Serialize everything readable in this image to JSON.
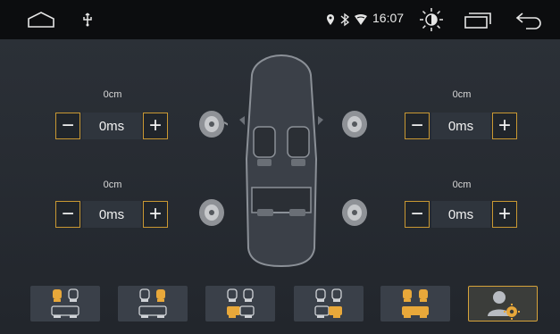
{
  "status_bar": {
    "time": "16:07",
    "icons": [
      "home-icon",
      "usb-icon",
      "location-icon",
      "bluetooth-icon",
      "wifi-icon",
      "brightness-icon",
      "recent-apps-icon",
      "back-icon"
    ]
  },
  "delay": {
    "front_left": {
      "distance": "0cm",
      "time": "0ms"
    },
    "front_right": {
      "distance": "0cm",
      "time": "0ms"
    },
    "rear_left": {
      "distance": "0cm",
      "time": "0ms"
    },
    "rear_right": {
      "distance": "0cm",
      "time": "0ms"
    },
    "minus_label": "−",
    "plus_label": "+"
  },
  "presets": {
    "icons": [
      "seat-driver-icon",
      "seat-front-right-icon",
      "seat-rear-left-icon",
      "seat-rear-right-icon",
      "seat-front-row-icon",
      "user-settings-icon"
    ],
    "active_color": "#e8a83a",
    "inactive_color": "#cfd2d6",
    "selected": "custom"
  }
}
